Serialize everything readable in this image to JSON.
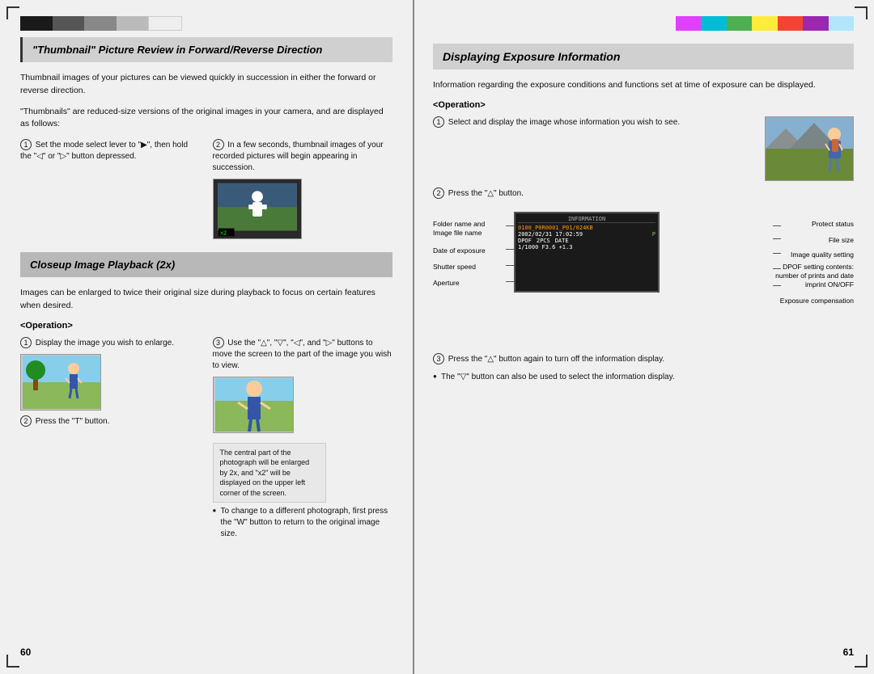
{
  "left_panel": {
    "color_strip": [
      "black",
      "dgray",
      "gray",
      "lgray",
      "white"
    ],
    "section1": {
      "title": "\"Thumbnail\" Picture Review in Forward/Reverse Direction",
      "body1": "Thumbnail images of your pictures can be viewed quickly in succession in either the forward or reverse direction.",
      "body2": "\"Thumbnails\" are reduced-size versions of the original images in your camera, and are displayed as follows:",
      "step1_num": "①",
      "step1_text": "Set the mode select lever to \"▶\", then hold the \"◁\" or \"▷\" button depressed.",
      "step2_num": "②",
      "step2_text": "In a few seconds, thumbnail images of your recorded pictures will begin appearing in succession."
    },
    "section2": {
      "title": "Closeup Image Playback (2x)",
      "body1": "Images can be enlarged to twice their original size during playback to focus on certain features when desired.",
      "operation": "<Operation>",
      "step1_num": "①",
      "step1_text": "Display the image you wish to enlarge.",
      "step2_num": "②",
      "step2_text": "Press the \"T\" button.",
      "step3_num": "③",
      "step3_text": "Use the \"△\", \"▽\", \"◁\", and \"▷\" buttons to move the screen to the part of the image you wish to view.",
      "bullet1": "To change to a different photograph, first press the \"W\" button to return to the original image size.",
      "note_text": "The central part of the photograph will be enlarged by 2x, and \"x2\" will be displayed on the upper left corner of the screen."
    },
    "page_number": "60"
  },
  "right_panel": {
    "color_strip": [
      "magenta",
      "cyan",
      "green",
      "yellow",
      "red",
      "purple",
      "ltblue"
    ],
    "section1": {
      "title": "Displaying Exposure Information",
      "body1": "Information regarding the exposure conditions and functions set at time of exposure can be displayed.",
      "operation": "<Operation>",
      "step1_num": "①",
      "step1_text": "Select and display the image whose information you wish to see.",
      "step2_num": "②",
      "step2_text": "Press the \"△\" button.",
      "diagram_labels": {
        "folder_image": "Folder name and\nImage file name",
        "date": "Date of exposure",
        "shutter": "Shutter speed",
        "aperture": "Aperture",
        "protect": "Protect status",
        "filesize": "File size",
        "quality": "Image quality setting",
        "dpof": "DPOF setting contents:\nnumber of prints and date\nimprint ON/OFF",
        "exposure_comp": "Exposure compensation"
      },
      "screen_data": {
        "row1": "0100_P0R0001_P01/024KB",
        "row2": "2002/02/31 17:02:59 P",
        "row3": "DPOF  2PCS  DATE",
        "row4": "1/1000 F3.6 +1.3"
      },
      "step3_num": "③",
      "step3_text": "Press the \"△\" button again to turn off the information display.",
      "bullet1": "The \"▽\" button can also be used to select the information display."
    },
    "page_number": "61"
  }
}
